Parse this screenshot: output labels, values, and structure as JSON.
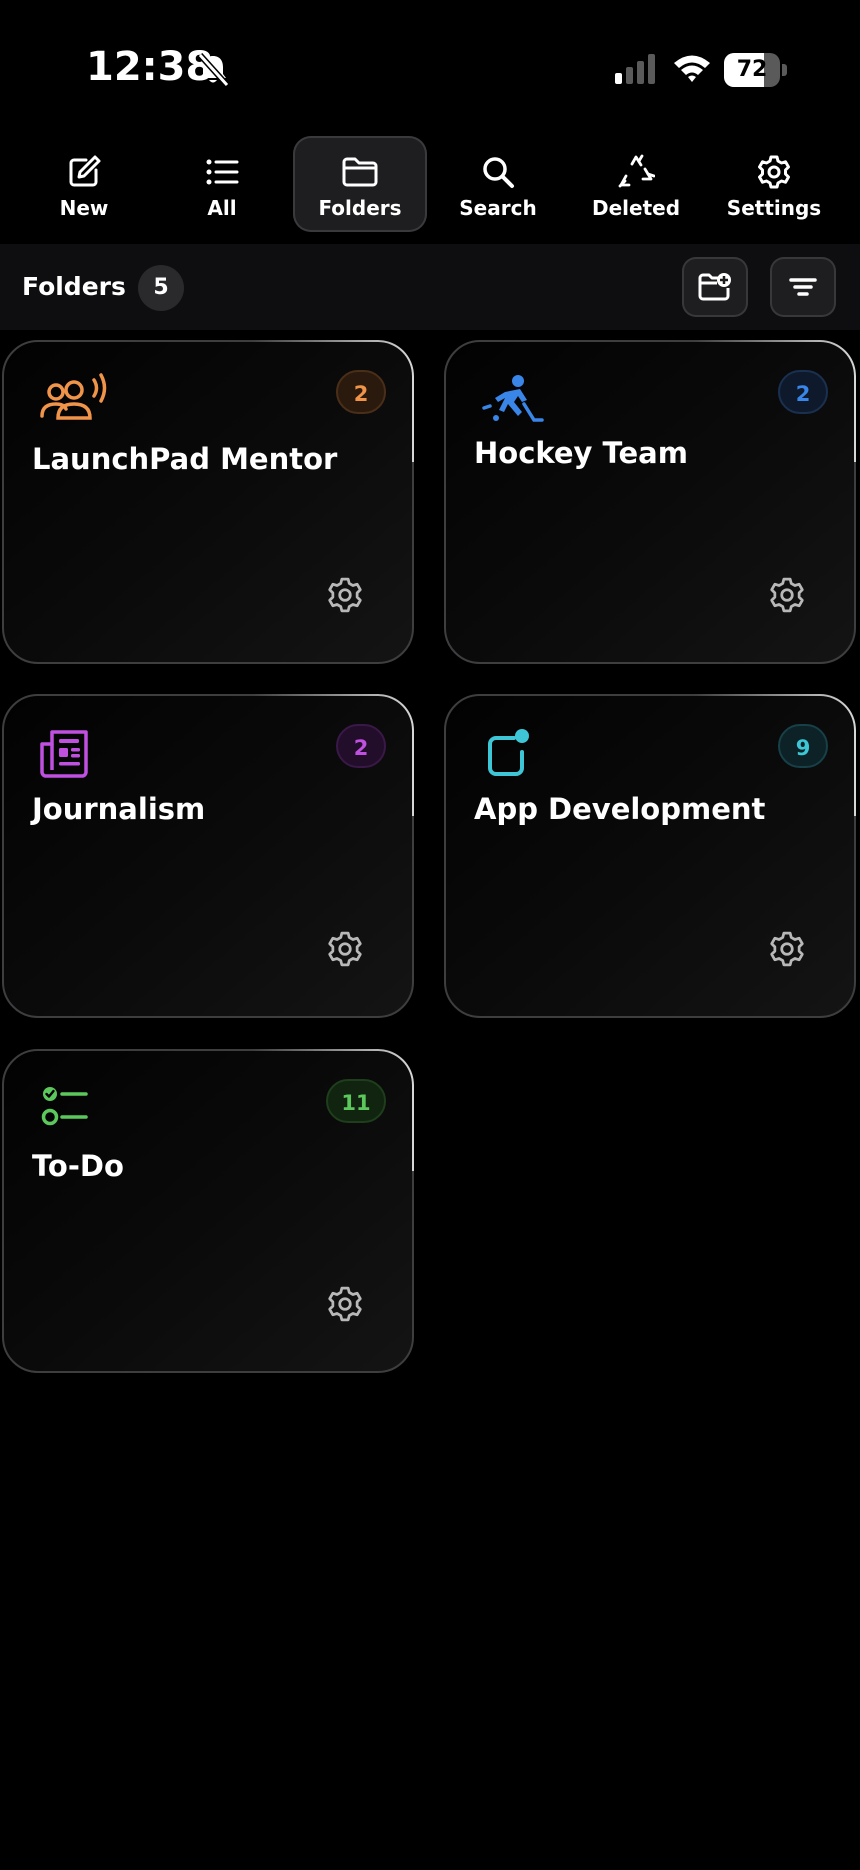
{
  "status_bar": {
    "time": "12:38",
    "battery": "72",
    "battery_level": 0.72
  },
  "nav": [
    {
      "label": "New",
      "icon": "compose-icon"
    },
    {
      "label": "All",
      "icon": "list-icon"
    },
    {
      "label": "Folders",
      "icon": "folder-icon",
      "active": true
    },
    {
      "label": "Search",
      "icon": "search-icon"
    },
    {
      "label": "Deleted",
      "icon": "recycle-icon"
    },
    {
      "label": "Settings",
      "icon": "gear-icon"
    }
  ],
  "header": {
    "title": "Folders",
    "count": "5"
  },
  "folders": [
    {
      "name": "LaunchPad Mentor",
      "count": "2",
      "icon": "people-speaking-icon",
      "color": "#f0944a"
    },
    {
      "name": "Hockey Team",
      "count": "2",
      "icon": "hockey-player-icon",
      "color": "#3a86e8"
    },
    {
      "name": "Journalism",
      "count": "2",
      "icon": "newspaper-icon",
      "color": "#c050e0"
    },
    {
      "name": "App Development",
      "count": "9",
      "icon": "app-badge-icon",
      "color": "#3ec6d6"
    },
    {
      "name": "To-Do",
      "count": "11",
      "icon": "checklist-icon",
      "color": "#5cc85c"
    }
  ]
}
